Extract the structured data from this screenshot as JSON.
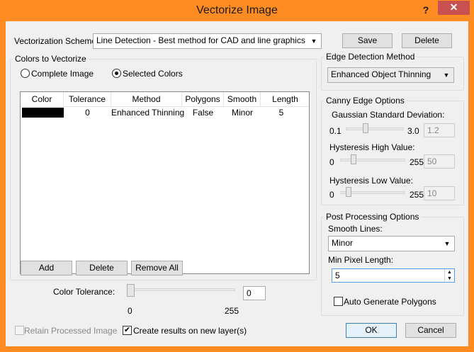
{
  "window": {
    "title": "Vectorize Image",
    "help": "?",
    "close": "✕"
  },
  "scheme": {
    "label": "Vectorization Scheme:",
    "selected": "Line Detection - Best method for CAD and line graphics",
    "save": "Save",
    "delete": "Delete"
  },
  "colors": {
    "group_title": "Colors to Vectorize",
    "radio_complete": "Complete Image",
    "radio_selected": "Selected Colors",
    "selected_choice": "Selected Colors",
    "columns": [
      "Color",
      "Tolerance",
      "Method",
      "Polygons",
      "Smooth",
      "Length"
    ],
    "rows": [
      {
        "color": "#000000",
        "tolerance": "0",
        "method": "Enhanced Thinning",
        "polygons": "False",
        "smooth": "Minor",
        "length": "5"
      }
    ],
    "add": "Add",
    "delete": "Delete",
    "remove_all": "Remove All",
    "tolerance_label": "Color Tolerance:",
    "tolerance_min": "0",
    "tolerance_max": "255",
    "tolerance_value": "0"
  },
  "edge": {
    "group_title": "Edge Detection Method",
    "selected": "Enhanced Object Thinning"
  },
  "canny": {
    "group_title": "Canny Edge Options",
    "gauss_label": "Gaussian Standard Deviation:",
    "gauss_min": "0.1",
    "gauss_max": "3.0",
    "gauss_value": "1.2",
    "high_label": "Hysteresis High Value:",
    "high_min": "0",
    "high_max": "255",
    "high_value": "50",
    "low_label": "Hysteresis Low Value:",
    "low_min": "0",
    "low_max": "255",
    "low_value": "10"
  },
  "post": {
    "group_title": "Post Processing Options",
    "smooth_label": "Smooth Lines:",
    "smooth_selected": "Minor",
    "min_len_label": "Min Pixel Length:",
    "min_len_value": "5",
    "auto_polygons": "Auto Generate Polygons",
    "auto_polygons_checked": false
  },
  "footer": {
    "retain": "Retain Processed Image",
    "retain_checked": false,
    "new_layer": "Create results on new layer(s)",
    "new_layer_checked": true,
    "ok": "OK",
    "cancel": "Cancel"
  },
  "colors_theme": {
    "frame": "#ff8c22",
    "close": "#c75050"
  }
}
